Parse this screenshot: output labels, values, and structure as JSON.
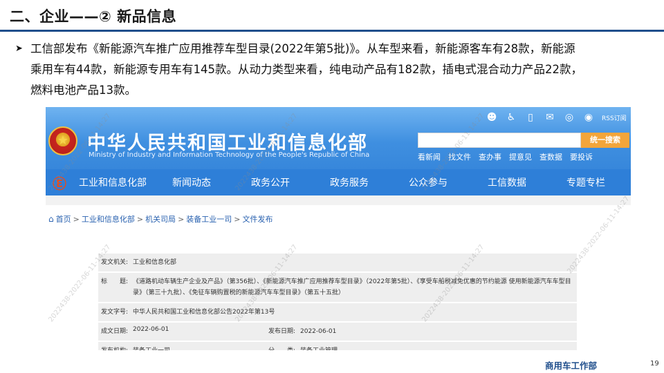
{
  "slide": {
    "title": "二、企业——② 新品信息",
    "bullet_lines": [
      "工信部发布《新能源汽车推广应用推荐车型目录(2022年第5批)》。从车型来看，新能源客车有28款，新能源",
      "乘用车有44款，新能源专用车有145款。从动力类型来看，纯电动产品有182款，插电式混合动力产品22款，",
      "燃料电池产品13款。"
    ],
    "footer_brand": "商用车工作部",
    "page_number": "19"
  },
  "website": {
    "site_name_cn": "中华人民共和国工业和信息化部",
    "site_name_en": "Ministry of Industry and Information Technology of the People's Republic of China",
    "rss_label": "RSS订阅",
    "search_button": "统一搜索",
    "quick_links": [
      "看新闻",
      "找文件",
      "查办事",
      "提意见",
      "查数据",
      "要投诉"
    ],
    "nav_items": [
      "工业和信息化部",
      "新闻动态",
      "政务公开",
      "政务服务",
      "公众参与",
      "工信数据",
      "专题专栏"
    ],
    "breadcrumb": [
      "首页",
      "工业和信息化部",
      "机关司局",
      "装备工业一司",
      "文件发布"
    ],
    "doc_info": {
      "issuer_label": "发文机关:",
      "issuer_value": "工业和信息化部",
      "title_label": "标　　题:",
      "title_value": "《道路机动车辆生产企业及产品》（第356批）、《新能源汽车推广应用推荐车型目录》（2022年第5批）、《享受车船税减免优惠的节约能源 使用新能源汽车车型目录》（第三十九批）、《免征车辆购置税的新能源汽车车型目录》（第五十五批）",
      "doc_no_label": "发文字号:",
      "doc_no_value": "中华人民共和国工业和信息化部公告2022年第13号",
      "created_label": "成文日期:",
      "created_value": "2022-06-01",
      "published_label": "发布日期:",
      "published_value": "2022-06-01",
      "org_label": "发布机构:",
      "org_value": "装备工业一司",
      "category_label": "分　　类:",
      "category_value": "装备工业管理"
    },
    "watermark_text": "2022438-2022-06-11-14:27"
  },
  "colors": {
    "title_rule": "#1f4e8c",
    "site_blue": "#2e7fd8",
    "search_orange": "#f3a53a",
    "link_blue": "#2a62b0"
  }
}
